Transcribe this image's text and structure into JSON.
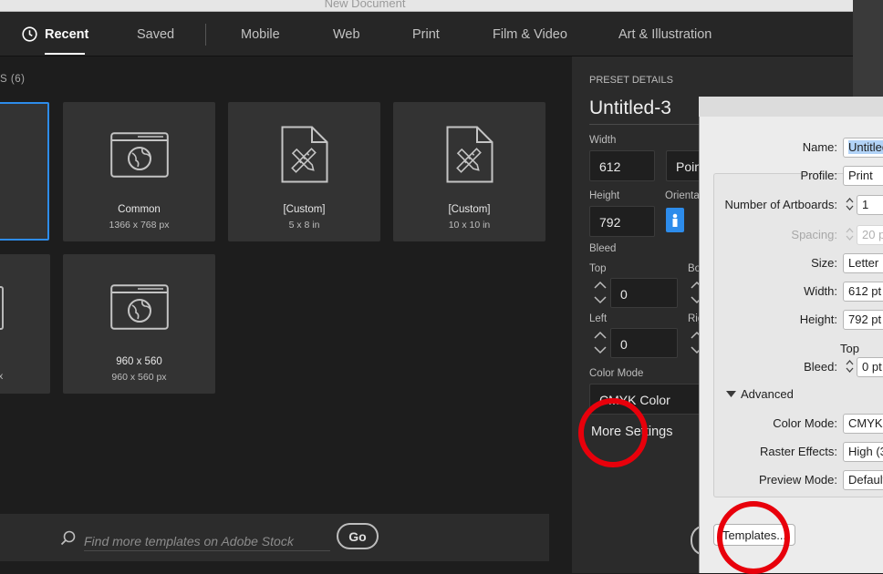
{
  "window": {
    "title": "New Document"
  },
  "tabs": [
    {
      "label": "Recent",
      "active": true
    },
    {
      "label": "Saved"
    },
    {
      "label": "Mobile"
    },
    {
      "label": "Web"
    },
    {
      "label": "Print"
    },
    {
      "label": "Film & Video"
    },
    {
      "label": "Art & Illustration"
    }
  ],
  "recent": {
    "section_label": "S  (6)",
    "cards": [
      {
        "name": "Common",
        "size": "1366 x 768 px",
        "icon": "web-icon"
      },
      {
        "name": "[Custom]",
        "size": "5 x 8 in",
        "icon": "document-pen-ruler-icon"
      },
      {
        "name": "[Custom]",
        "size": "10 x 10 in",
        "icon": "document-pen-ruler-icon"
      },
      {
        "name": "960 x 560",
        "size": "960 x 560 px",
        "icon": "web-icon"
      }
    ],
    "partial_card_size": "x"
  },
  "search": {
    "placeholder": "Find more templates on Adobe Stock",
    "go_label": "Go"
  },
  "preset": {
    "header": "PRESET DETAILS",
    "name": "Untitled-3",
    "width_label": "Width",
    "width_value": "612",
    "units_value": "Poin",
    "height_label": "Height",
    "height_value": "792",
    "orientation_label": "Orientat",
    "bleed_label": "Bleed",
    "top_label": "Top",
    "top_value": "0",
    "bottom_label": "Bo",
    "left_label": "Left",
    "left_value": "0",
    "right_label": "Rig",
    "color_mode_label": "Color Mode",
    "color_mode_value": "CMYK Color",
    "more_settings": "More Settings"
  },
  "dialog": {
    "name_label": "Name:",
    "name_value": "Untitled",
    "profile_label": "Profile:",
    "profile_value": "Print",
    "artboards_label": "Number of Artboards:",
    "artboards_value": "1",
    "spacing_label": "Spacing:",
    "spacing_value": "20 p",
    "size_label": "Size:",
    "size_value": "Letter",
    "width_label": "Width:",
    "width_value": "612 pt",
    "height_label": "Height:",
    "height_value": "792 pt",
    "top_label": "Top",
    "bleed_label": "Bleed:",
    "bleed_value": "0 pt",
    "advanced_label": "Advanced",
    "color_mode_label": "Color Mode:",
    "color_mode_value": "CMYK",
    "raster_label": "Raster Effects:",
    "raster_value": "High (3",
    "preview_label": "Preview Mode:",
    "preview_value": "Default",
    "templates_label": "Templates..."
  },
  "colors": {
    "accent": "#2d8ceb",
    "annotation": "#e8000b"
  }
}
